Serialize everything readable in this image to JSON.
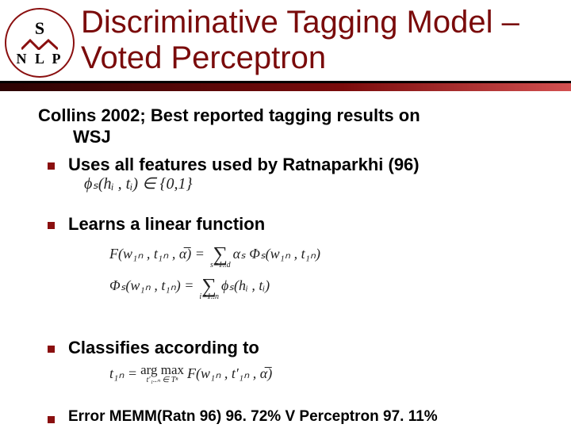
{
  "logo": {
    "letter": "S",
    "acronym": "N L P"
  },
  "title": "Discriminative Tagging Model – Voted Perceptron",
  "lead": {
    "line1": "Collins 2002; Best reported tagging results on",
    "line2": "WSJ"
  },
  "bullets": {
    "b1": "Uses all features used by Ratnaparkhi (96)",
    "b1_formula": "ϕₛ(hᵢ , tᵢ) ∈ {0,1}",
    "b2": "Learns a linear function",
    "b2_formula1_lhs": "F(w₁ₙ , t₁ₙ , α̅) =",
    "b2_formula1_sumlimits_top": "",
    "b2_formula1_sumlimits_bot": "s=1..d",
    "b2_formula1_rhs": "αₛ Φₛ(w₁ₙ , t₁ₙ)",
    "b2_formula2_lhs": "Φₛ(w₁ₙ , t₁ₙ) =",
    "b2_formula2_sumlimits_bot": "i=1..n",
    "b2_formula2_rhs": "ϕₛ(hᵢ , tᵢ)",
    "b3": "Classifies according to",
    "b3_formula_lhs": "t₁ₙ =",
    "b3_argmax_top": "arg max",
    "b3_argmax_bot": "t′₁..ₙ ∈ Tⁿ",
    "b3_formula_rhs": "F(w₁ₙ , t′₁ₙ , α̅)",
    "b4_pre": "Error MEMM(Ratn 96) ",
    "b4_v1": "96. 72%",
    "b4_mid": " V Perceptron ",
    "b4_v2": "97. 11%"
  }
}
